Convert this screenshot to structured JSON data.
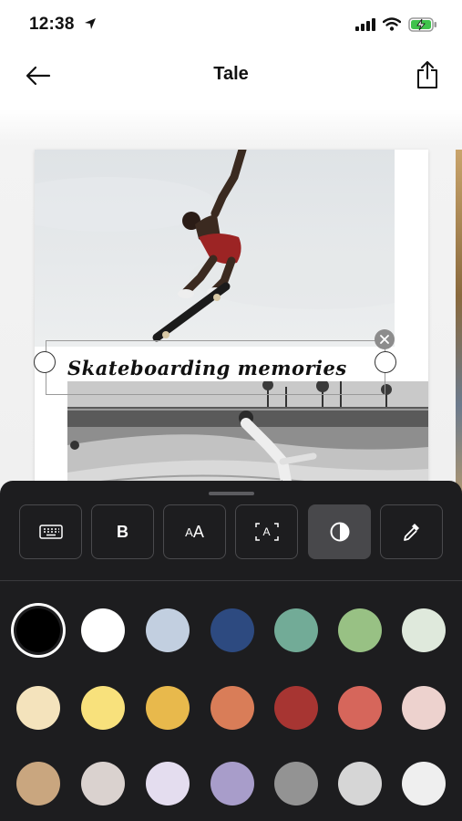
{
  "status_bar": {
    "time": "12:38"
  },
  "nav": {
    "title": "Tale"
  },
  "editor": {
    "caption_text": "Skateboarding memories"
  },
  "toolbar": {
    "tools": [
      {
        "name": "keyboard",
        "icon": "keyboard-icon"
      },
      {
        "name": "bold",
        "label": "B"
      },
      {
        "name": "font-size",
        "label_small": "A",
        "label_large": "A"
      },
      {
        "name": "text-background",
        "label": "A"
      },
      {
        "name": "color",
        "icon": "contrast-icon",
        "active": true
      },
      {
        "name": "eyedropper",
        "icon": "eyedropper-icon"
      }
    ]
  },
  "colors": {
    "selected_index": 0,
    "swatches": [
      "#000000",
      "#ffffff",
      "#c2cfe0",
      "#2d4a80",
      "#72ab97",
      "#98c184",
      "#dfe9dc",
      "#f4e3bc",
      "#f8e17c",
      "#e8b94c",
      "#d97d58",
      "#a73532",
      "#d6665b",
      "#edd2ce",
      "#c9a67f",
      "#dad2cf",
      "#e4ddef",
      "#a89dca",
      "#939393",
      "#d6d6d6",
      "#efefef"
    ]
  }
}
